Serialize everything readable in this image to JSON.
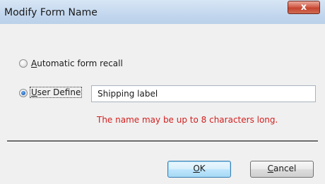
{
  "window": {
    "title": "Modify Form Name",
    "close_glyph": "x"
  },
  "options": {
    "automatic": {
      "label_hotkey": "A",
      "label_rest": "utomatic form recall",
      "checked": false
    },
    "user_define": {
      "label_hotkey": "U",
      "label_rest": "ser Define",
      "checked": true
    }
  },
  "name_field": {
    "value": "Shipping label"
  },
  "hint": "The name may be up to 8 characters long.",
  "buttons": {
    "ok_hotkey": "O",
    "ok_rest": "K",
    "cancel_hotkey": "C",
    "cancel_rest": "ancel"
  },
  "colors": {
    "hint_text": "#d21f1f",
    "dialog_bg": "#f0f0f0",
    "titlebar": "#c3d7ee"
  }
}
